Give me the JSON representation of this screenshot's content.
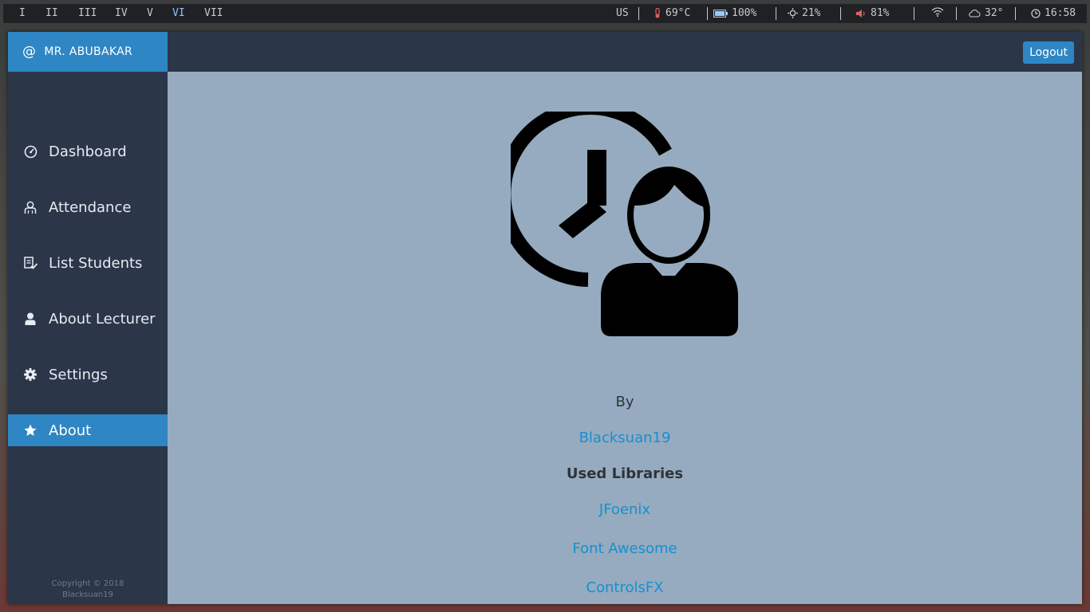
{
  "topbar": {
    "workspaces": [
      "I",
      "II",
      "III",
      "IV",
      "V",
      "VI",
      "VII"
    ],
    "active_workspace": "VI",
    "keyboard": "US",
    "temperature": "69°C",
    "battery": "100%",
    "brightness": "21%",
    "volume": "81%",
    "weather": "32°",
    "clock": "16:58"
  },
  "sidebar": {
    "user": "MR. ABUBAKAR",
    "items": [
      {
        "label": "Dashboard",
        "icon": "dashboard-gauge-icon"
      },
      {
        "label": "Attendance",
        "icon": "attendance-icon"
      },
      {
        "label": "List Students",
        "icon": "list-check-icon"
      },
      {
        "label": "About Lecturer",
        "icon": "user-icon"
      },
      {
        "label": "Settings",
        "icon": "gear-icon"
      },
      {
        "label": "About",
        "icon": "star-icon"
      }
    ],
    "active": "About",
    "copyright_line1": "Copyright © 2018",
    "copyright_line2": "Blacksuan19"
  },
  "header": {
    "logout_label": "Logout"
  },
  "about": {
    "logo_icon": "clock-user-icon",
    "by_label": "By",
    "author": "Blacksuan19",
    "libraries_heading": "Used Libraries",
    "libraries": [
      "JFoenix",
      "Font Awesome",
      "ControlsFX"
    ]
  },
  "colors": {
    "accent": "#2e86c4",
    "sidebar_bg": "#2c3649",
    "content_bg": "#96abbf",
    "link": "#1590d1"
  }
}
